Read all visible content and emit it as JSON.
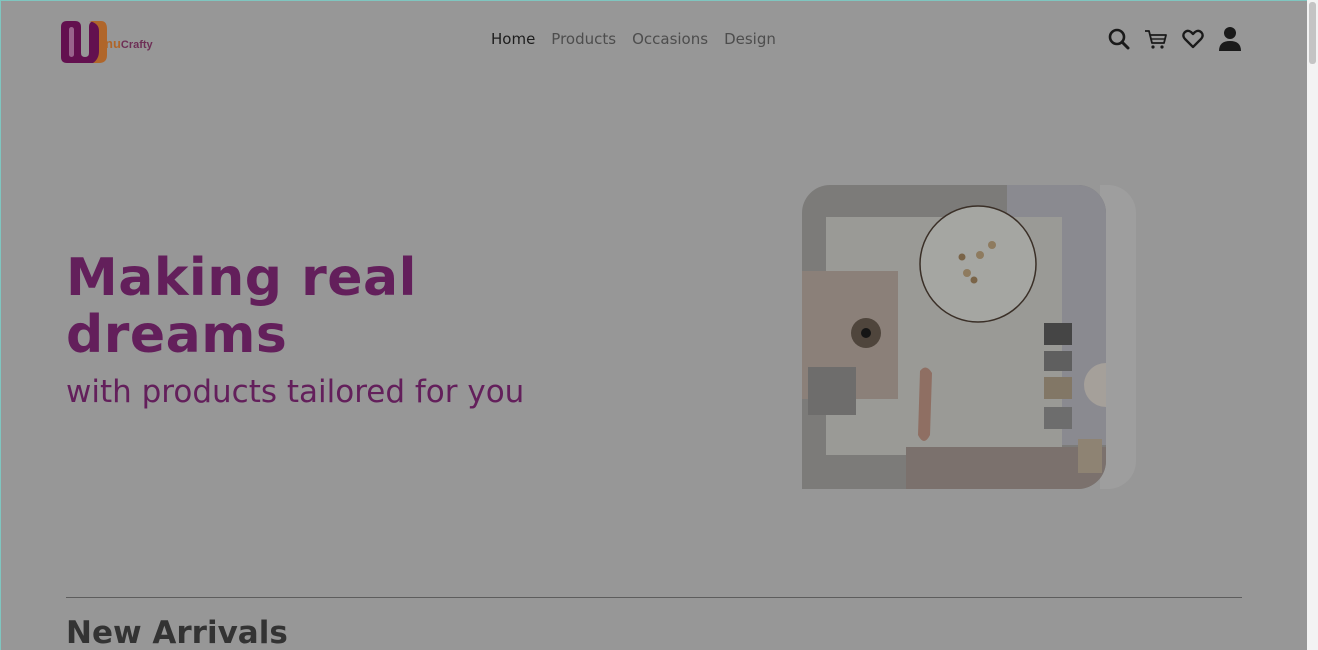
{
  "brand": {
    "logo_prefix": "nu",
    "logo_name": "Crafty"
  },
  "nav": {
    "items": [
      {
        "label": "Home",
        "active": true
      },
      {
        "label": "Products",
        "active": false
      },
      {
        "label": "Occasions",
        "active": false
      },
      {
        "label": "Design",
        "active": false
      }
    ]
  },
  "header_icons": [
    "search-icon",
    "cart-icon",
    "heart-icon",
    "user-icon"
  ],
  "hero": {
    "title": "Making real dreams",
    "subtitle": "with products tailored for you"
  },
  "sections": {
    "new_arrivals": "New Arrivals"
  },
  "colors": {
    "brand_purple": "#631f5b",
    "overlay_gray": "#979797",
    "logo_orange": "#b0662a"
  }
}
